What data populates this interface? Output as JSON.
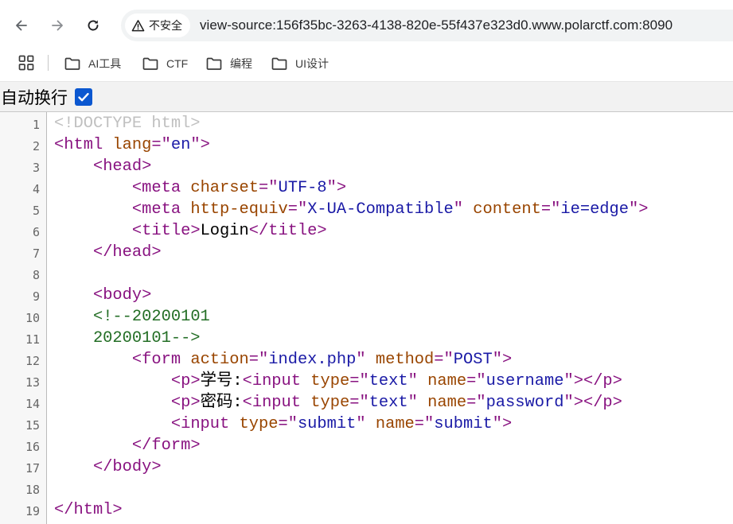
{
  "browser": {
    "security_label": "不安全",
    "url": "view-source:156f35bc-3263-4138-820e-55f437e323d0.www.polarctf.com:8090"
  },
  "bookmarks": [
    {
      "label": "AI工具",
      "icon": "folder-icon"
    },
    {
      "label": "CTF",
      "icon": "folder-icon"
    },
    {
      "label": "编程",
      "icon": "folder-icon"
    },
    {
      "label": "UI设计",
      "icon": "folder-icon"
    }
  ],
  "viewsource": {
    "wrap_label": "自动换行",
    "wrap_checked": true
  },
  "source_lines": [
    [
      {
        "k": "d",
        "s": "<!DOCTYPE html>"
      }
    ],
    [
      {
        "k": "t",
        "s": "<html "
      },
      {
        "k": "a",
        "s": "lang"
      },
      {
        "k": "t",
        "s": "=\""
      },
      {
        "k": "v",
        "s": "en"
      },
      {
        "k": "t",
        "s": "\">"
      }
    ],
    [
      {
        "k": "x",
        "s": "    "
      },
      {
        "k": "t",
        "s": "<head>"
      }
    ],
    [
      {
        "k": "x",
        "s": "        "
      },
      {
        "k": "t",
        "s": "<meta "
      },
      {
        "k": "a",
        "s": "charset"
      },
      {
        "k": "t",
        "s": "=\""
      },
      {
        "k": "v",
        "s": "UTF-8"
      },
      {
        "k": "t",
        "s": "\">"
      }
    ],
    [
      {
        "k": "x",
        "s": "        "
      },
      {
        "k": "t",
        "s": "<meta "
      },
      {
        "k": "a",
        "s": "http-equiv"
      },
      {
        "k": "t",
        "s": "=\""
      },
      {
        "k": "v",
        "s": "X-UA-Compatible"
      },
      {
        "k": "t",
        "s": "\" "
      },
      {
        "k": "a",
        "s": "content"
      },
      {
        "k": "t",
        "s": "=\""
      },
      {
        "k": "v",
        "s": "ie=edge"
      },
      {
        "k": "t",
        "s": "\">"
      }
    ],
    [
      {
        "k": "x",
        "s": "        "
      },
      {
        "k": "t",
        "s": "<title>"
      },
      {
        "k": "x",
        "s": "Login"
      },
      {
        "k": "t",
        "s": "</title>"
      }
    ],
    [
      {
        "k": "x",
        "s": "    "
      },
      {
        "k": "t",
        "s": "</head>"
      }
    ],
    [
      {
        "k": "x",
        "s": ""
      }
    ],
    [
      {
        "k": "x",
        "s": "    "
      },
      {
        "k": "t",
        "s": "<body>"
      }
    ],
    [
      {
        "k": "x",
        "s": "    "
      },
      {
        "k": "c",
        "s": "<!--20200101"
      }
    ],
    [
      {
        "k": "c",
        "s": "    20200101-->"
      }
    ],
    [
      {
        "k": "x",
        "s": "        "
      },
      {
        "k": "t",
        "s": "<form "
      },
      {
        "k": "a",
        "s": "action"
      },
      {
        "k": "t",
        "s": "=\""
      },
      {
        "k": "v",
        "s": "index.php"
      },
      {
        "k": "t",
        "s": "\" "
      },
      {
        "k": "a",
        "s": "method"
      },
      {
        "k": "t",
        "s": "=\""
      },
      {
        "k": "v",
        "s": "POST"
      },
      {
        "k": "t",
        "s": "\">"
      }
    ],
    [
      {
        "k": "x",
        "s": "            "
      },
      {
        "k": "t",
        "s": "<p>"
      },
      {
        "k": "x",
        "s": "学号:"
      },
      {
        "k": "t",
        "s": "<input "
      },
      {
        "k": "a",
        "s": "type"
      },
      {
        "k": "t",
        "s": "=\""
      },
      {
        "k": "v",
        "s": "text"
      },
      {
        "k": "t",
        "s": "\" "
      },
      {
        "k": "a",
        "s": "name"
      },
      {
        "k": "t",
        "s": "=\""
      },
      {
        "k": "v",
        "s": "username"
      },
      {
        "k": "t",
        "s": "\">"
      },
      {
        "k": "t",
        "s": "</p>"
      }
    ],
    [
      {
        "k": "x",
        "s": "            "
      },
      {
        "k": "t",
        "s": "<p>"
      },
      {
        "k": "x",
        "s": "密码:"
      },
      {
        "k": "t",
        "s": "<input "
      },
      {
        "k": "a",
        "s": "type"
      },
      {
        "k": "t",
        "s": "=\""
      },
      {
        "k": "v",
        "s": "text"
      },
      {
        "k": "t",
        "s": "\" "
      },
      {
        "k": "a",
        "s": "name"
      },
      {
        "k": "t",
        "s": "=\""
      },
      {
        "k": "v",
        "s": "password"
      },
      {
        "k": "t",
        "s": "\">"
      },
      {
        "k": "t",
        "s": "</p>"
      }
    ],
    [
      {
        "k": "x",
        "s": "            "
      },
      {
        "k": "t",
        "s": "<input "
      },
      {
        "k": "a",
        "s": "type"
      },
      {
        "k": "t",
        "s": "=\""
      },
      {
        "k": "v",
        "s": "submit"
      },
      {
        "k": "t",
        "s": "\" "
      },
      {
        "k": "a",
        "s": "name"
      },
      {
        "k": "t",
        "s": "=\""
      },
      {
        "k": "v",
        "s": "submit"
      },
      {
        "k": "t",
        "s": "\">"
      }
    ],
    [
      {
        "k": "x",
        "s": "        "
      },
      {
        "k": "t",
        "s": "</form>"
      }
    ],
    [
      {
        "k": "x",
        "s": "    "
      },
      {
        "k": "t",
        "s": "</body>"
      }
    ],
    [
      {
        "k": "x",
        "s": ""
      }
    ],
    [
      {
        "k": "t",
        "s": "</html>"
      }
    ]
  ]
}
